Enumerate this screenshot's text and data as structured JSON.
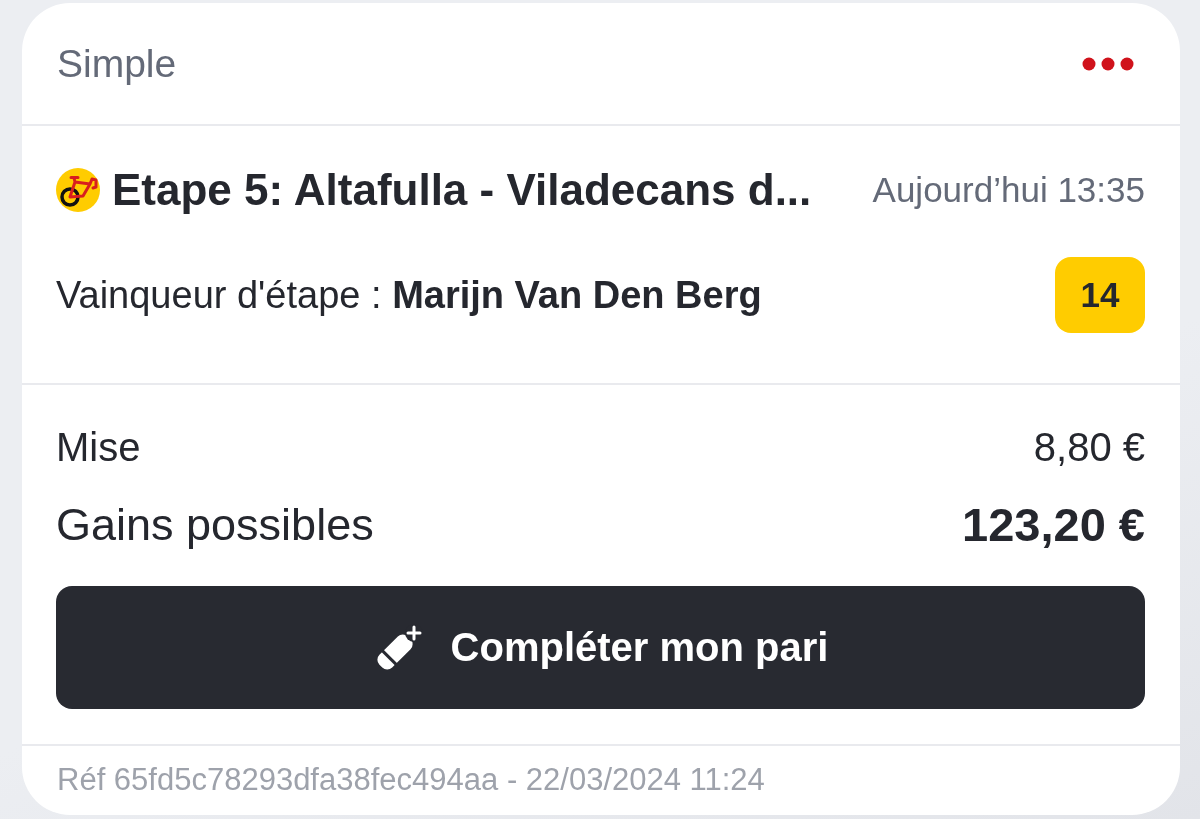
{
  "header": {
    "title": "Simple"
  },
  "selection": {
    "event": "Etape 5: Altafulla - Viladecans d...",
    "time": "Aujourd’hui 13:35",
    "market": "Vainqueur d'étape : **Marijn Van Den Berg**",
    "odds": "14"
  },
  "summary": [
    {
      "kind": "plain",
      "label": "Mise",
      "value": "8,80 €"
    },
    {
      "kind": "total",
      "label": "Gains possibles",
      "value": "123,20 €"
    }
  ],
  "button": {
    "label": "Compléter mon pari"
  },
  "footer": {
    "reference": "Réf 65fd5c78293dfa38fec494aa - 22/03/2024 11:24"
  }
}
